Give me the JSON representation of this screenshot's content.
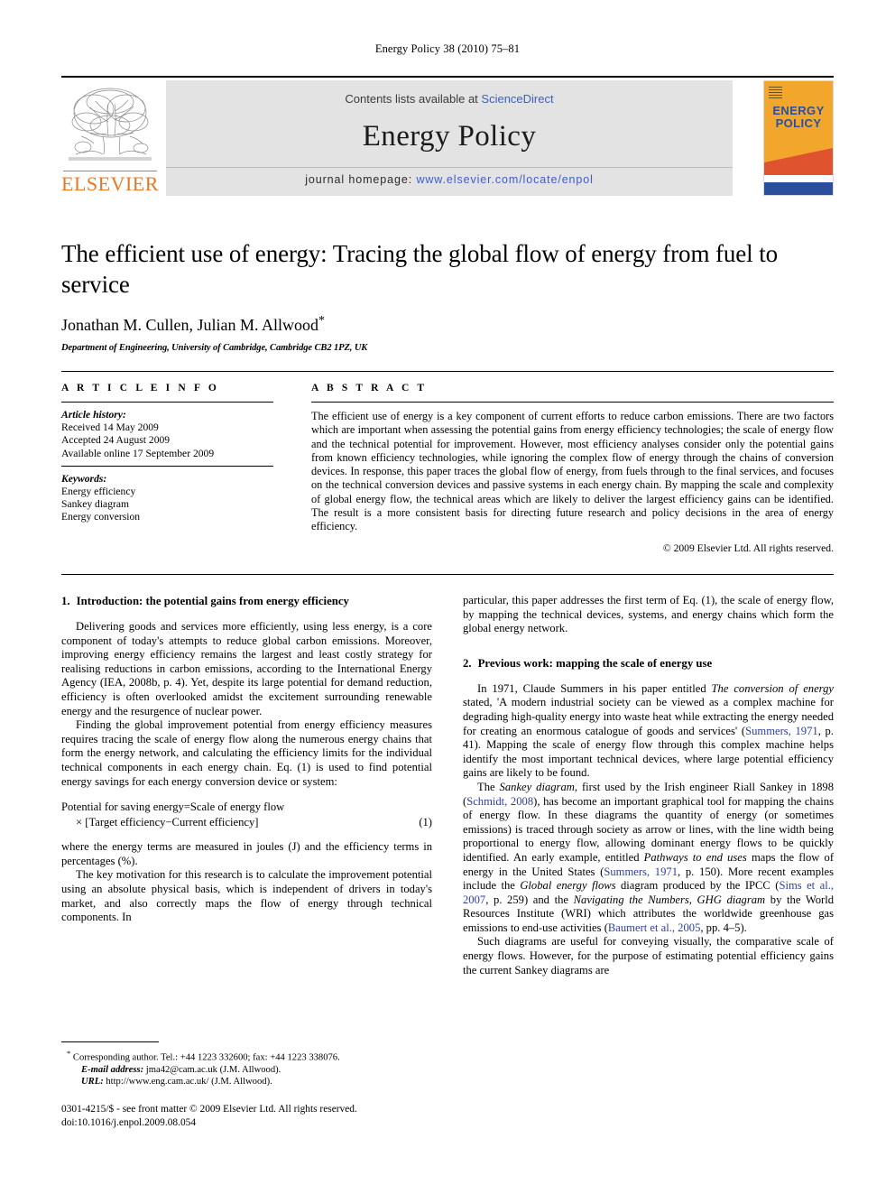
{
  "running_head": "Energy Policy 38 (2010) 75–81",
  "masthead": {
    "contents_prefix": "Contents lists available at ",
    "sciencedirect": "ScienceDirect",
    "journal_title": "Energy Policy",
    "homepage_prefix": "journal homepage: ",
    "homepage_url": "www.elsevier.com/locate/enpol",
    "publisher_wordmark": "ELSEVIER",
    "cover_title_line1": "ENERGY",
    "cover_title_line2": "POLICY",
    "colors": {
      "link": "#3a5fcd",
      "elsevier_orange": "#e87722",
      "cover_background": "#f2a72c",
      "cover_blue": "#2b4f9e",
      "cover_red": "#e0532f",
      "band_grey": "#e3e3e3"
    }
  },
  "title_block": {
    "title": "The efficient use of energy: Tracing the global flow of energy from fuel to service",
    "authors": "Jonathan M. Cullen, Julian M. Allwood",
    "corresponding_marker": "*",
    "affiliation": "Department of Engineering, University of Cambridge, Cambridge CB2 1PZ, UK"
  },
  "article_info": {
    "heading": "A R T I C L E  I N F O",
    "history_label": "Article history:",
    "history": [
      "Received 14 May 2009",
      "Accepted 24 August 2009",
      "Available online 17 September 2009"
    ],
    "keywords_label": "Keywords:",
    "keywords": [
      "Energy efficiency",
      "Sankey diagram",
      "Energy conversion"
    ]
  },
  "abstract": {
    "heading": "A B S T R A C T",
    "text": "The efficient use of energy is a key component of current efforts to reduce carbon emissions. There are two factors which are important when assessing the potential gains from energy efficiency technologies; the scale of energy flow and the technical potential for improvement. However, most efficiency analyses consider only the potential gains from known efficiency technologies, while ignoring the complex flow of energy through the chains of conversion devices. In response, this paper traces the global flow of energy, from fuels through to the final services, and focuses on the technical conversion devices and passive systems in each energy chain. By mapping the scale and complexity of global energy flow, the technical areas which are likely to deliver the largest efficiency gains can be identified. The result is a more consistent basis for directing future research and policy decisions in the area of energy efficiency.",
    "copyright": "© 2009 Elsevier Ltd. All rights reserved."
  },
  "sections": {
    "s1": {
      "number": "1.",
      "title": "Introduction: the potential gains from energy efficiency",
      "p1": "Delivering goods and services more efficiently, using less energy, is a core component of today's attempts to reduce global carbon emissions. Moreover, improving energy efficiency remains the largest and least costly strategy for realising reductions in carbon emissions, according to the International Energy Agency (IEA, 2008b, p. 4). Yet, despite its large potential for demand reduction, efficiency is often overlooked amidst the excitement surrounding renewable energy and the resurgence of nuclear power.",
      "p2": "Finding the global improvement potential from energy efficiency measures requires tracing the scale of energy flow along the numerous energy chains that form the energy network, and calculating the efficiency limits for the individual technical components in each energy chain. Eq. (1) is used to find potential energy savings for each energy conversion device or system:",
      "equation_line1": "Potential for saving energy=Scale of energy flow",
      "equation_line2": "× [Target efficiency−Current efficiency]",
      "equation_number": "(1)",
      "p3": "where the energy terms are measured in joules (J) and the efficiency terms in percentages (%).",
      "p4_left": "The key motivation for this research is to calculate the improvement potential using an absolute physical basis, which is independent of drivers in today's market, and also correctly maps the flow of energy through technical components. In",
      "p4_right": "particular, this paper addresses the first term of Eq. (1), the scale of energy flow, by mapping the technical devices, systems, and energy chains which form the global energy network."
    },
    "s2": {
      "number": "2.",
      "title": "Previous work: mapping the scale of energy use",
      "p1_a": "In 1971, Claude Summers in his paper entitled ",
      "p1_it1": "The conversion of energy",
      "p1_b": " stated, 'A modern industrial society can be viewed as a complex machine for degrading high-quality energy into waste heat while extracting the energy needed for creating an enormous catalogue of goods and services' (",
      "p1_cit1": "Summers, 1971",
      "p1_c": ", p. 41). Mapping the scale of energy flow through this complex machine helps identify the most important technical devices, where large potential efficiency gains are likely to be found.",
      "p2_a": "The ",
      "p2_it1": "Sankey diagram",
      "p2_b": ", first used by the Irish engineer Riall Sankey in 1898 (",
      "p2_cit1": "Schmidt, 2008",
      "p2_c": "), has become an important graphical tool for mapping the chains of energy flow. In these diagrams the quantity of energy (or sometimes emissions) is traced through society as arrow or lines, with the line width being proportional to energy flow, allowing dominant energy flows to be quickly identified. An early example, entitled ",
      "p2_it2": "Pathways to end uses",
      "p2_d": " maps the flow of energy in the United States (",
      "p2_cit2": "Summers, 1971",
      "p2_e": ", p. 150). More recent examples include the ",
      "p2_it3": "Global energy flows",
      "p2_f": " diagram produced by the IPCC (",
      "p2_cit3": "Sims et al., 2007",
      "p2_g": ", p. 259) and the ",
      "p2_it4": "Navigating the Numbers, GHG diagram",
      "p2_h": " by the World Resources Institute (WRI) which attributes the worldwide greenhouse gas emissions to end-use activities (",
      "p2_cit4": "Baumert et al., 2005",
      "p2_i": ", pp. 4–5).",
      "p3": "Such diagrams are useful for conveying visually, the comparative scale of energy flows. However, for the purpose of estimating potential efficiency gains the current Sankey diagrams are"
    }
  },
  "footnotes": {
    "corresponding": "Corresponding author. Tel.: +44 1223 332600; fax: +44 1223 338076.",
    "email_label": "E-mail address:",
    "email_value": " jma42@cam.ac.uk (J.M. Allwood).",
    "url_label": "URL:",
    "url_value": " http://www.eng.cam.ac.uk/ (J.M. Allwood).",
    "imprint_line1": "0301-4215/$ - see front matter © 2009 Elsevier Ltd. All rights reserved.",
    "imprint_line2": "doi:10.1016/j.enpol.2009.08.054"
  }
}
